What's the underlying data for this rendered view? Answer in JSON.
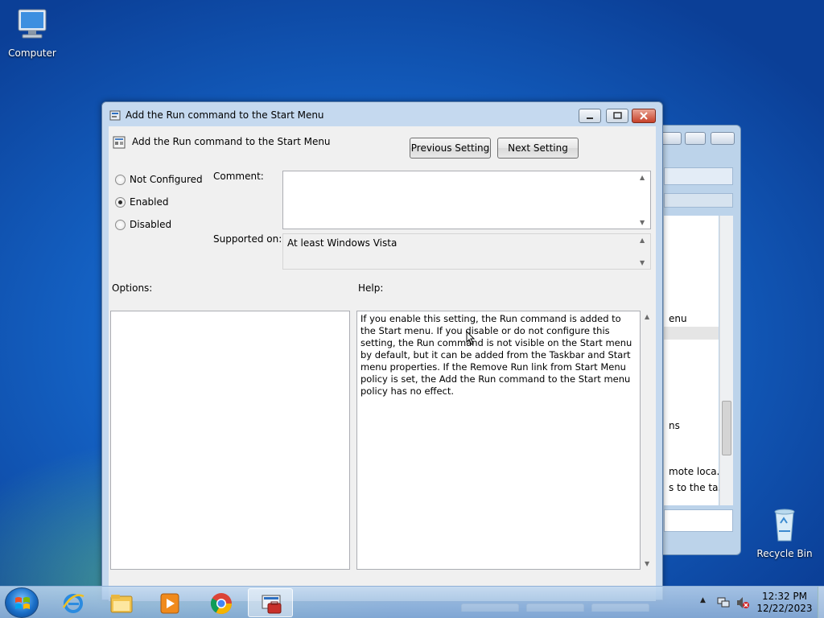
{
  "desktop": {
    "computer_label": "Computer",
    "recycle_label": "Recycle Bin"
  },
  "back_window": {
    "lines": [
      "enu",
      "ns",
      "mote loca...",
      "s to the ta..."
    ]
  },
  "dialog": {
    "title": "Add the Run command to the Start Menu",
    "setting_name": "Add the Run command to the Start Menu",
    "prev_button": "Previous Setting",
    "next_button": "Next Setting",
    "options": {
      "not_configured": "Not Configured",
      "enabled": "Enabled",
      "disabled": "Disabled",
      "selected": "Enabled"
    },
    "comment_label": "Comment:",
    "comment_value": "",
    "supported_label": "Supported on:",
    "supported_value": "At least Windows Vista",
    "options_label": "Options:",
    "help_label": "Help:",
    "help_text": "If you enable this setting, the Run command is added to the Start menu.  If you disable or do not configure this setting, the Run command is not visible on the Start menu by default, but it can be added from the Taskbar and Start menu properties. If the Remove Run link from Start Menu policy is set, the Add the Run command to the Start menu policy has no effect."
  },
  "taskbar": {
    "apps": [
      "internet-explorer",
      "windows-explorer",
      "media-player",
      "chrome",
      "group-policy-editor"
    ],
    "active_app": "group-policy-editor",
    "time": "12:32 PM",
    "date": "12/22/2023"
  },
  "colors": {
    "desktop_blue": "#1565c8",
    "dialog_frame": "#c5d9ef",
    "close_red": "#c7412a"
  }
}
